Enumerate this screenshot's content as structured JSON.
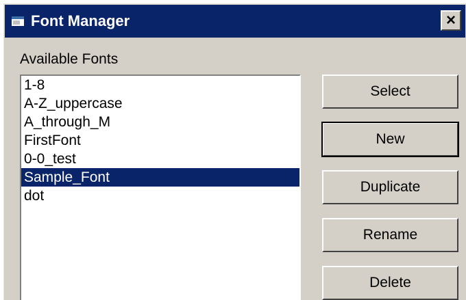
{
  "window": {
    "title": "Font Manager",
    "close_glyph": "×",
    "icon": "app-window-icon"
  },
  "fonts_label": "Available Fonts",
  "fonts": [
    "1-8",
    "A-Z_uppercase",
    "A_through_M",
    "FirstFont",
    "0-0_test",
    "Sample_Font",
    "dot"
  ],
  "selected_font": "Sample_Font",
  "buttons": {
    "select": "Select",
    "new": "New",
    "duplicate": "Duplicate",
    "rename": "Rename",
    "delete": "Delete"
  },
  "colors": {
    "titlebar": "#0a246a",
    "selection": "#0a246a",
    "face": "#d4d0c8"
  }
}
